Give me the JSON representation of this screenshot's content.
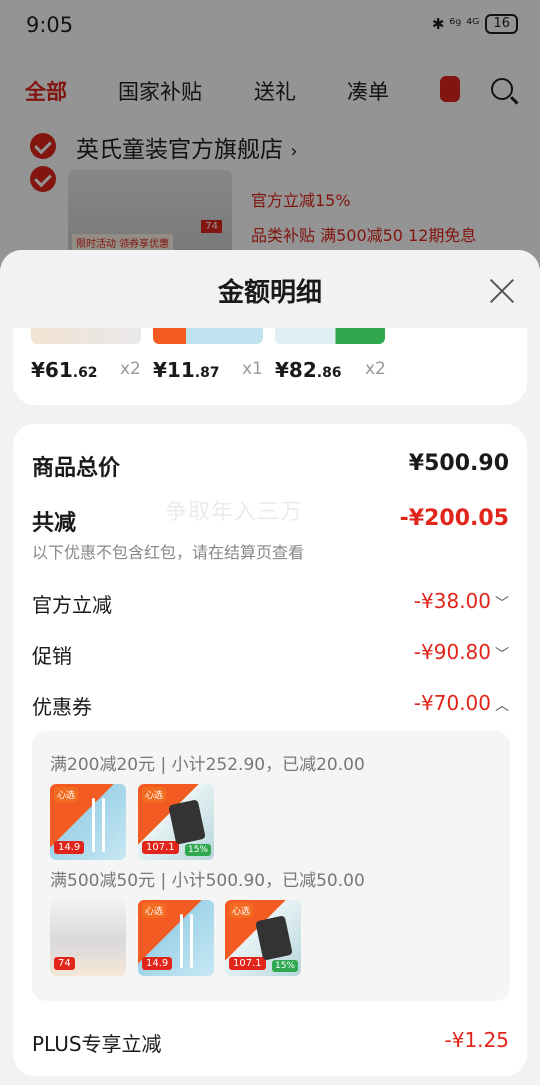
{
  "status_bar": {
    "time": "9:05",
    "icons": "✱ ⁶ᵍ ⁴ᴳ",
    "battery": "16"
  },
  "tabs": [
    "全部",
    "国家补贴",
    "送礼",
    "凑单"
  ],
  "store": {
    "name": "英氏童装官方旗舰店",
    "chevron": "›",
    "promo_line1": "官方立减15%",
    "promo_line2": "品类补贴 满500减50  12期免息",
    "thumb_tag": "限时活动 领券享优惠",
    "thumb_num": "74"
  },
  "sheet": {
    "title": "金额明细",
    "items": [
      {
        "price_int": "¥61",
        "price_dec": ".62",
        "qty": "x2"
      },
      {
        "price_int": "¥11",
        "price_dec": ".87",
        "qty": "x1"
      },
      {
        "price_int": "¥82",
        "price_dec": ".86",
        "qty": "x2"
      }
    ],
    "total_label": "商品总价",
    "total_value": "¥500.90",
    "discount_label": "共减",
    "discount_value": "-¥200.05",
    "discount_hint": "以下优惠不包含红包，请在结算页查看",
    "watermark": "争取年入三万",
    "rows": [
      {
        "label": "官方立减",
        "value": "-¥38.00",
        "chevron": "﹀"
      },
      {
        "label": "促销",
        "value": "-¥90.80",
        "chevron": "﹀"
      },
      {
        "label": "优惠券",
        "value": "-¥70.00",
        "chevron": "︿"
      }
    ],
    "coupons": [
      {
        "line": "满200减20元 | 小计252.90，已减20.00",
        "products": [
          {
            "kind": "cable",
            "tag": "心选",
            "price": "14.9"
          },
          {
            "kind": "charger",
            "tag": "心选",
            "price": "107.1",
            "badge": "15%"
          }
        ]
      },
      {
        "line": "满500减50元 | 小计500.90，已减50.00",
        "products": [
          {
            "kind": "kids",
            "tag": "",
            "price": "74"
          },
          {
            "kind": "cable",
            "tag": "心选",
            "price": "14.9"
          },
          {
            "kind": "charger",
            "tag": "心选",
            "price": "107.1",
            "badge": "15%"
          }
        ]
      }
    ],
    "plus_label": "PLUS专享立减",
    "plus_value": "-¥1.25"
  }
}
